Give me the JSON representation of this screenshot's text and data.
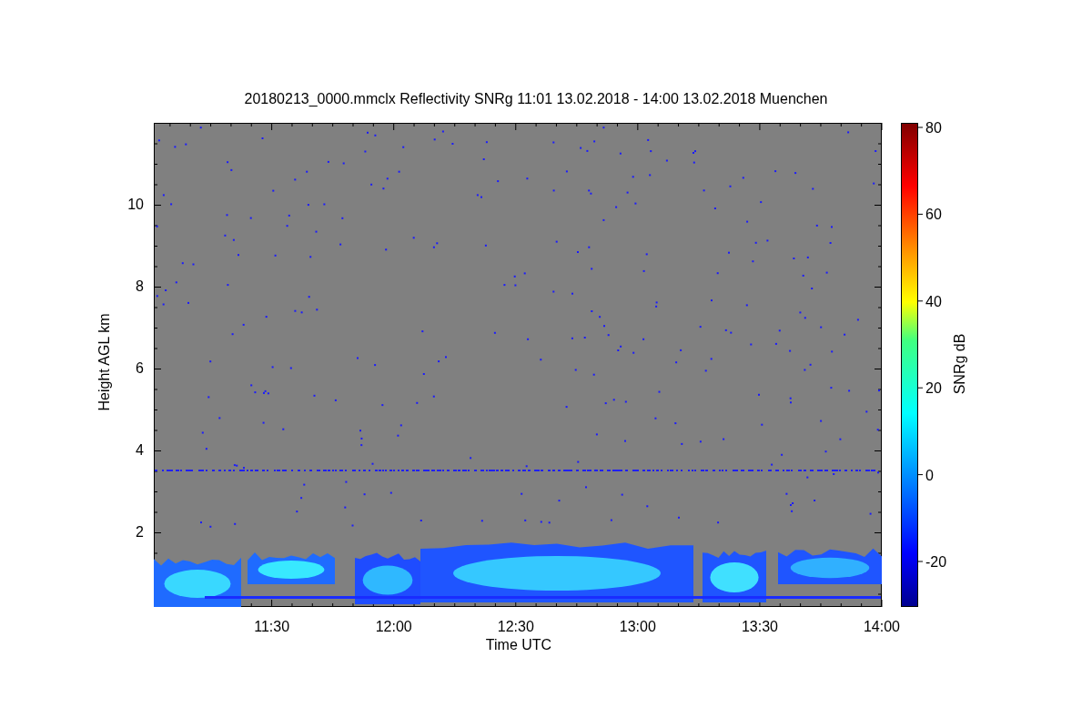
{
  "title": "20180213_0000.mmclx Reflectivity SNRg   11:01 13.02.2018 - 14:00 13.02.2018 Muenchen",
  "y_axis": {
    "label": "Height AGL km",
    "ticks": [
      "10",
      "8",
      "6",
      "4",
      "2"
    ]
  },
  "x_axis": {
    "label": "Time UTC",
    "ticks": [
      "11:30",
      "12:00",
      "12:30",
      "13:00",
      "13:30",
      "14:00"
    ]
  },
  "colorbar": {
    "label": "SNRg dB",
    "ticks": [
      "80",
      "60",
      "40",
      "20",
      "0",
      "-20"
    ]
  }
}
